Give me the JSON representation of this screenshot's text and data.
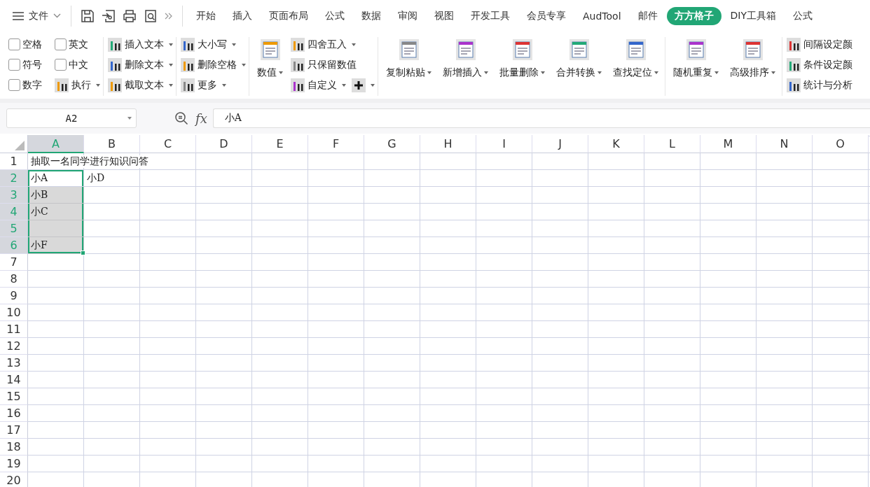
{
  "topbar": {
    "menu_label": "文件",
    "tabs": [
      {
        "label": "开始",
        "selected": false
      },
      {
        "label": "插入",
        "selected": false
      },
      {
        "label": "页面布局",
        "selected": false
      },
      {
        "label": "公式",
        "selected": false
      },
      {
        "label": "数据",
        "selected": false
      },
      {
        "label": "审阅",
        "selected": false
      },
      {
        "label": "视图",
        "selected": false
      },
      {
        "label": "开发工具",
        "selected": false
      },
      {
        "label": "会员专享",
        "selected": false
      },
      {
        "label": "AudTool",
        "selected": false
      },
      {
        "label": "邮件",
        "selected": false
      },
      {
        "label": "方方格子",
        "selected": true
      },
      {
        "label": "DIY工具箱",
        "selected": false
      },
      {
        "label": "公式",
        "selected": false
      }
    ]
  },
  "ribbon": {
    "groups": [
      {
        "sections": [
          {
            "kind": "stack",
            "rows": [
              [
                {
                  "kind": "checkbox",
                  "label": "空格",
                  "checked": false
                },
                {
                  "kind": "checkbox",
                  "label": "英文",
                  "checked": false
                }
              ],
              [
                {
                  "kind": "checkbox",
                  "label": "符号",
                  "checked": false
                },
                {
                  "kind": "checkbox",
                  "label": "中文",
                  "checked": false
                }
              ],
              [
                {
                  "kind": "checkbox",
                  "label": "数字",
                  "checked": false
                },
                {
                  "kind": "small",
                  "label": "执行",
                  "dropdown": true
                }
              ]
            ]
          }
        ]
      },
      {
        "sections": [
          {
            "kind": "stack",
            "rows": [
              [
                {
                  "kind": "small",
                  "label": "插入文本",
                  "dropdown": true
                }
              ],
              [
                {
                  "kind": "small",
                  "label": "删除文本",
                  "dropdown": true
                }
              ],
              [
                {
                  "kind": "small",
                  "label": "截取文本",
                  "dropdown": true
                }
              ]
            ]
          }
        ]
      },
      {
        "sections": [
          {
            "kind": "stack",
            "rows": [
              [
                {
                  "kind": "small",
                  "label": "大小写",
                  "dropdown": true
                }
              ],
              [
                {
                  "kind": "small",
                  "label": "删除空格",
                  "dropdown": true
                }
              ],
              [
                {
                  "kind": "small",
                  "label": "更多",
                  "dropdown": true
                }
              ]
            ]
          }
        ]
      },
      {
        "sections": [
          {
            "kind": "large",
            "label": "数值",
            "dropdown": true
          },
          {
            "kind": "stack",
            "rows": [
              [
                {
                  "kind": "small",
                  "label": "四舍五入",
                  "dropdown": true
                }
              ],
              [
                {
                  "kind": "small",
                  "label": "只保留数值",
                  "dropdown": false
                }
              ],
              [
                {
                  "kind": "small",
                  "label": "自定义",
                  "dropdown": true
                },
                {
                  "kind": "plus",
                  "dropdown": true
                }
              ]
            ]
          }
        ]
      },
      {
        "sections": [
          {
            "kind": "large",
            "label": "复制粘贴",
            "dropdown": true
          },
          {
            "kind": "large",
            "label": "新增插入",
            "dropdown": true
          },
          {
            "kind": "large",
            "label": "批量删除",
            "dropdown": true
          },
          {
            "kind": "large",
            "label": "合并转换",
            "dropdown": true
          },
          {
            "kind": "large",
            "label": "查找定位",
            "dropdown": true
          }
        ]
      },
      {
        "sections": [
          {
            "kind": "large",
            "label": "随机重复",
            "dropdown": true
          },
          {
            "kind": "large",
            "label": "高级排序",
            "dropdown": true
          }
        ]
      },
      {
        "sections": [
          {
            "kind": "stack",
            "rows": [
              [
                {
                  "kind": "small",
                  "label": "间隔设定颜",
                  "dropdown": false
                }
              ],
              [
                {
                  "kind": "small",
                  "label": "条件设定颜",
                  "dropdown": false
                }
              ],
              [
                {
                  "kind": "small",
                  "label": "统计与分析",
                  "dropdown": false
                }
              ]
            ]
          }
        ]
      }
    ]
  },
  "formula_bar": {
    "name_box": "A2",
    "fx": "fx",
    "formula": "小A"
  },
  "sheet": {
    "columns": [
      {
        "label": "A",
        "selected": true
      },
      {
        "label": "B",
        "selected": false
      },
      {
        "label": "C",
        "selected": false
      },
      {
        "label": "D",
        "selected": false
      },
      {
        "label": "E",
        "selected": false
      },
      {
        "label": "F",
        "selected": false
      },
      {
        "label": "G",
        "selected": false
      },
      {
        "label": "H",
        "selected": false
      },
      {
        "label": "I",
        "selected": false
      },
      {
        "label": "J",
        "selected": false
      },
      {
        "label": "K",
        "selected": false
      },
      {
        "label": "L",
        "selected": false
      },
      {
        "label": "M",
        "selected": false
      },
      {
        "label": "N",
        "selected": false
      },
      {
        "label": "O",
        "selected": false
      }
    ],
    "rows": [
      {
        "label": "1",
        "selected": false,
        "cells": [
          {
            "text": "抽取一名同学进行知识问答",
            "selected": false
          }
        ]
      },
      {
        "label": "2",
        "selected": true,
        "cells": [
          {
            "text": "小A",
            "selected": true,
            "active": true
          },
          {
            "text": "小D",
            "selected": false
          }
        ]
      },
      {
        "label": "3",
        "selected": true,
        "cells": [
          {
            "text": "小B",
            "selected": true
          }
        ]
      },
      {
        "label": "4",
        "selected": true,
        "cells": [
          {
            "text": "小C",
            "selected": true
          }
        ]
      },
      {
        "label": "5",
        "selected": true,
        "cells": [
          {
            "selected": true
          }
        ]
      },
      {
        "label": "6",
        "selected": true,
        "cells": [
          {
            "text": "小F",
            "selected": true
          }
        ]
      },
      {
        "label": "7",
        "selected": false
      },
      {
        "label": "8",
        "selected": false
      },
      {
        "label": "9",
        "selected": false
      },
      {
        "label": "10",
        "selected": false
      },
      {
        "label": "11",
        "selected": false
      },
      {
        "label": "12",
        "selected": false
      },
      {
        "label": "13",
        "selected": false
      },
      {
        "label": "14",
        "selected": false
      },
      {
        "label": "15",
        "selected": false
      },
      {
        "label": "16",
        "selected": false
      },
      {
        "label": "17",
        "selected": false
      },
      {
        "label": "18",
        "selected": false
      },
      {
        "label": "19",
        "selected": false
      },
      {
        "label": "20",
        "selected": false
      }
    ]
  }
}
